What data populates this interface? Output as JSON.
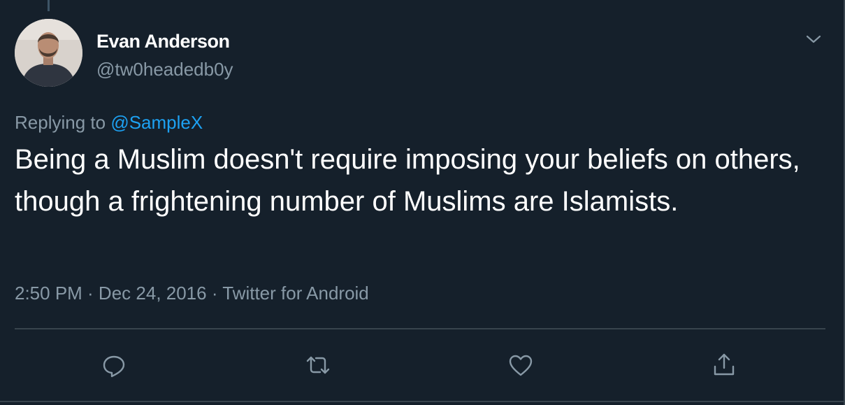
{
  "tweet": {
    "author_name": "Evan Anderson",
    "author_handle": "@tw0headedb0y",
    "replying_prefix": "Replying to",
    "replying_to": "@SampleX",
    "text": "Being a Muslim doesn't require imposing your beliefs on others, though a frightening number of Muslims are Islamists.",
    "meta": "2:50 PM · Dec 24, 2016 · Twitter for Android"
  },
  "icons": {
    "more": "chevron-down-icon",
    "reply": "speech-bubble-icon",
    "retweet": "retweet-icon",
    "like": "heart-icon",
    "share": "share-upload-icon"
  },
  "colors": {
    "background": "#15202b",
    "text_primary": "#ffffff",
    "text_secondary": "#8899a6",
    "link": "#1da1f2",
    "border": "#38444d"
  }
}
